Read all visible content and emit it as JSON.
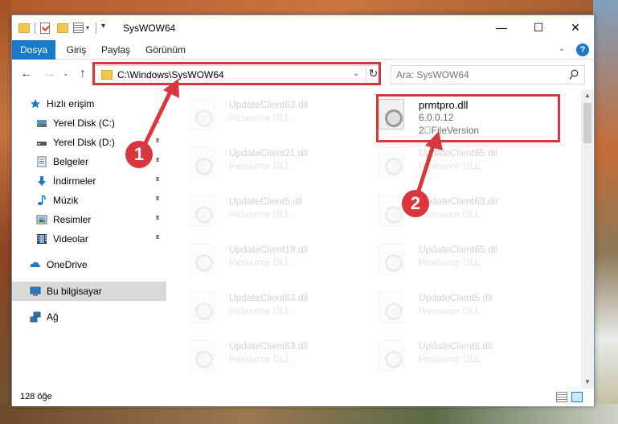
{
  "window": {
    "title": "SysWOW64",
    "minimize_glyph": "—",
    "maximize_glyph": "☐",
    "close_glyph": "✕"
  },
  "quick_access_toolbar": {
    "dropdown_glyph": "▾",
    "props_dropdown_glyph": "▾"
  },
  "ribbon": {
    "tabs": [
      {
        "label": "Dosya"
      },
      {
        "label": "Giriş"
      },
      {
        "label": "Paylaş"
      },
      {
        "label": "Görünüm"
      }
    ],
    "expand_glyph": "⌄",
    "help_glyph": "?"
  },
  "navigation": {
    "back_glyph": "←",
    "forward_glyph": "→",
    "recent_glyph": "⌄",
    "up_glyph": "↑"
  },
  "address_bar": {
    "path": "C:\\Windows\\SysWOW64",
    "dropdown_glyph": "⌄",
    "refresh_glyph": "↻"
  },
  "search": {
    "placeholder": "Ara: SysWOW64"
  },
  "sidebar": {
    "items": [
      {
        "label": "Hızlı erişim",
        "icon": "star-icon",
        "pinned": false
      },
      {
        "label": "Yerel Disk (C:)",
        "icon": "drive-icon",
        "pinned": true
      },
      {
        "label": "Yerel Disk (D:)",
        "icon": "drive-icon",
        "pinned": true
      },
      {
        "label": "Belgeler",
        "icon": "documents-icon",
        "pinned": true
      },
      {
        "label": "İndirmeler",
        "icon": "download-icon",
        "pinned": true
      },
      {
        "label": "Müzik",
        "icon": "music-icon",
        "pinned": true
      },
      {
        "label": "Resimler",
        "icon": "pictures-icon",
        "pinned": true
      },
      {
        "label": "Videolar",
        "icon": "video-icon",
        "pinned": true
      },
      {
        "label": "OneDrive",
        "icon": "cloud-icon",
        "pinned": false
      },
      {
        "label": "Bu bilgisayar",
        "icon": "computer-icon",
        "pinned": false
      },
      {
        "label": "Ağ",
        "icon": "network-icon",
        "pinned": false
      }
    ]
  },
  "files": {
    "highlighted": {
      "name": "prmtpro.dll",
      "version": "6.0.0.12",
      "description": "2\u0000FileVersion"
    },
    "left_column": [
      {
        "name": "UpdateClient63.dll",
        "type": "Resource DLL"
      },
      {
        "name": "UpdateClient21.dll",
        "type": "Resource DLL"
      },
      {
        "name": "UpdateClient5.dll",
        "type": "Resource DLL"
      },
      {
        "name": "UpdateClient19.dll",
        "type": "Resource DLL"
      },
      {
        "name": "UpdateClient63.dll",
        "type": "Resource DLL"
      },
      {
        "name": "UpdateClient63.dll",
        "type": "Resource DLL"
      }
    ],
    "right_column": [
      {
        "name": "UpdateClient65.dll",
        "type": "Resource DLL"
      },
      {
        "name": "UpdateClient63.dll",
        "type": "Resource DLL"
      },
      {
        "name": "UpdateClient65.dll",
        "type": "Resource DLL"
      },
      {
        "name": "UpdateClient5.dll",
        "type": "Resource DLL"
      },
      {
        "name": "UpdateClient5.dll",
        "type": "Resource DLL"
      }
    ]
  },
  "status_bar": {
    "item_count": "128 öğe"
  },
  "scrollbar": {
    "up_glyph": "▲",
    "down_glyph": "▼"
  },
  "callouts": {
    "first": "1",
    "second": "2"
  },
  "colors": {
    "accent": "#1979ca",
    "highlight": "#d9363e",
    "selection": "#d9d9d9"
  }
}
